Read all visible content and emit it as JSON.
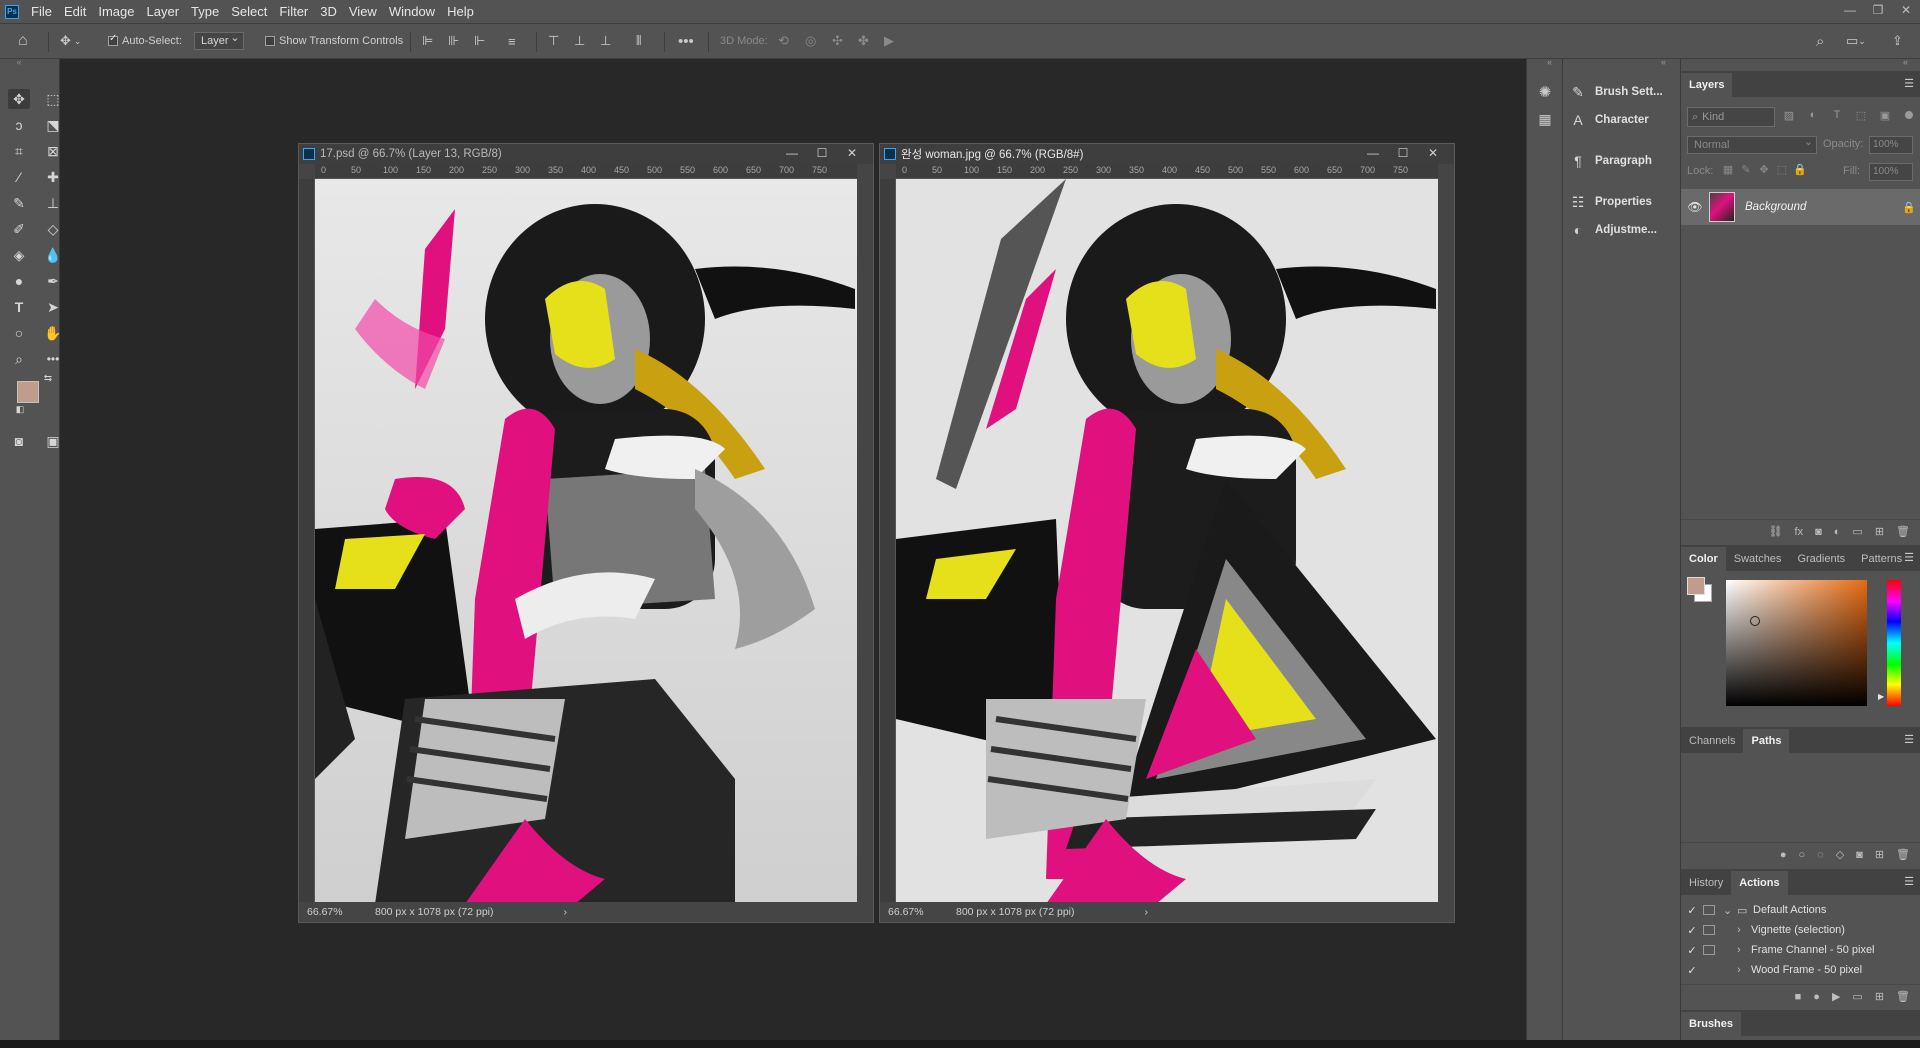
{
  "menubar": {
    "items": [
      "File",
      "Edit",
      "Image",
      "Layer",
      "Type",
      "Select",
      "Filter",
      "3D",
      "View",
      "Window",
      "Help"
    ]
  },
  "optionsbar": {
    "auto_select_label": "Auto-Select:",
    "auto_select_checked": true,
    "layer_select_value": "Layer",
    "show_transform_label": "Show Transform Controls",
    "mode_3d_label": "3D Mode:"
  },
  "documents": [
    {
      "title": "17.psd @ 66.7% (Layer 13, RGB/8)",
      "zoom": "66.67%",
      "size": "800 px x 1078 px (72 ppi)",
      "ruler": [
        "0",
        "50",
        "100",
        "150",
        "200",
        "250",
        "300",
        "350",
        "400",
        "450",
        "500",
        "550",
        "600",
        "650",
        "700",
        "750"
      ]
    },
    {
      "title": "완성 woman.jpg @ 66.7% (RGB/8#)",
      "zoom": "66.67%",
      "size": "800 px x 1078 px (72 ppi)",
      "ruler": [
        "0",
        "50",
        "100",
        "150",
        "200",
        "250",
        "300",
        "350",
        "400",
        "450",
        "500",
        "550",
        "600",
        "650",
        "700",
        "750"
      ]
    }
  ],
  "panel_names": {
    "brush_settings": "Brush Sett...",
    "character": "Character",
    "paragraph": "Paragraph",
    "properties": "Properties",
    "adjustments": "Adjustme..."
  },
  "layers_panel": {
    "tab": "Layers",
    "kind_placeholder": "Kind",
    "blend_mode": "Normal",
    "opacity_label": "Opacity:",
    "opacity_value": "100%",
    "lock_label": "Lock:",
    "fill_label": "Fill:",
    "fill_value": "100%",
    "layers": [
      {
        "name": "Background",
        "visible": true,
        "locked": true
      }
    ]
  },
  "color_panel": {
    "tabs": [
      "Color",
      "Swatches",
      "Gradients",
      "Patterns"
    ],
    "foreground": "#bf9c8c",
    "background": "#ffffff"
  },
  "channels_panel": {
    "tabs": [
      "Channels",
      "Paths"
    ]
  },
  "actions_panel": {
    "tabs": [
      "History",
      "Actions"
    ],
    "items": [
      {
        "label": "Default Actions",
        "type": "set"
      },
      {
        "label": "Vignette (selection)",
        "type": "action"
      },
      {
        "label": "Frame Channel - 50 pixel",
        "type": "action"
      },
      {
        "label": "Wood Frame - 50 pixel",
        "type": "action"
      }
    ]
  },
  "brushes_panel": {
    "tab": "Brushes"
  },
  "toolbar": {
    "foreground": "#bf9c8c",
    "background": "#ffffff"
  },
  "colors": {
    "magenta": "#e0107f",
    "yellow": "#e6e01a"
  }
}
